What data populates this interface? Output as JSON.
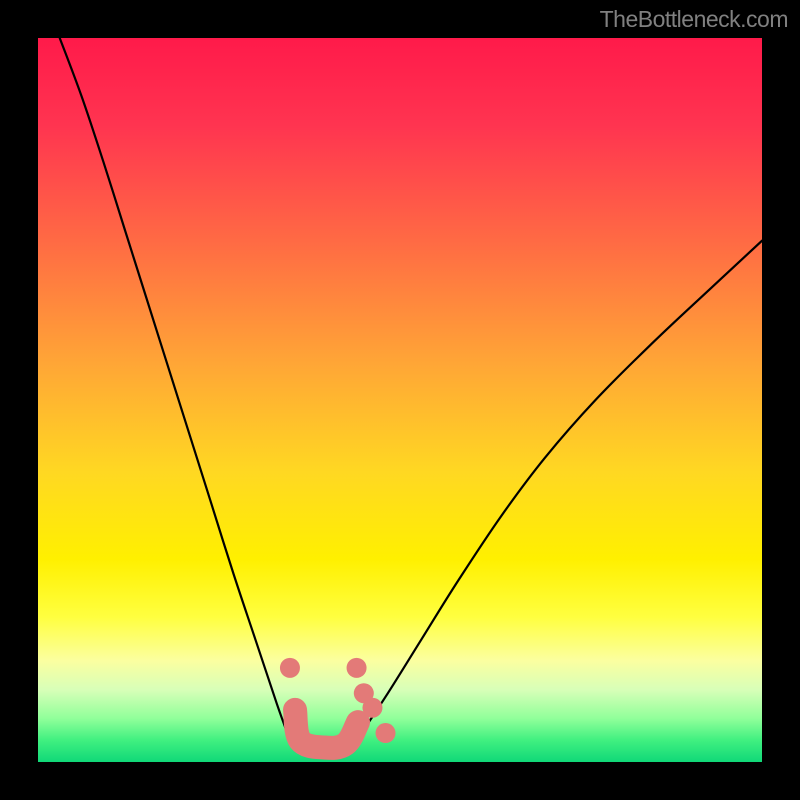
{
  "watermark": "TheBottleneck.com",
  "chart_data": {
    "type": "line",
    "title": "",
    "xlabel": "",
    "ylabel": "",
    "xlim": [
      0,
      1
    ],
    "ylim": [
      0,
      1
    ],
    "background": {
      "type": "vertical-gradient",
      "stops": [
        {
          "offset": 0.0,
          "color": "#ff1a4a"
        },
        {
          "offset": 0.12,
          "color": "#ff3450"
        },
        {
          "offset": 0.28,
          "color": "#ff6a44"
        },
        {
          "offset": 0.45,
          "color": "#ffa636"
        },
        {
          "offset": 0.6,
          "color": "#ffd822"
        },
        {
          "offset": 0.72,
          "color": "#fff000"
        },
        {
          "offset": 0.8,
          "color": "#ffff40"
        },
        {
          "offset": 0.86,
          "color": "#fbffa0"
        },
        {
          "offset": 0.9,
          "color": "#d8ffb8"
        },
        {
          "offset": 0.94,
          "color": "#90ff9a"
        },
        {
          "offset": 0.97,
          "color": "#40f080"
        },
        {
          "offset": 1.0,
          "color": "#10d878"
        }
      ]
    },
    "series": [
      {
        "name": "left-curve",
        "x": [
          0.03,
          0.06,
          0.09,
          0.12,
          0.15,
          0.18,
          0.21,
          0.24,
          0.27,
          0.3,
          0.33,
          0.348
        ],
        "y": [
          1.0,
          0.92,
          0.83,
          0.735,
          0.64,
          0.545,
          0.45,
          0.355,
          0.26,
          0.17,
          0.08,
          0.03
        ]
      },
      {
        "name": "right-curve",
        "x": [
          0.44,
          0.48,
          0.53,
          0.58,
          0.64,
          0.7,
          0.77,
          0.85,
          0.93,
          1.0
        ],
        "y": [
          0.03,
          0.09,
          0.17,
          0.25,
          0.34,
          0.42,
          0.5,
          0.58,
          0.655,
          0.72
        ]
      }
    ],
    "markers": [
      {
        "x": 0.348,
        "y": 0.13,
        "r": 10
      },
      {
        "x": 0.44,
        "y": 0.13,
        "r": 10
      },
      {
        "x": 0.45,
        "y": 0.095,
        "r": 10
      },
      {
        "x": 0.462,
        "y": 0.075,
        "r": 10
      },
      {
        "x": 0.48,
        "y": 0.04,
        "r": 10
      }
    ],
    "thick_segment": {
      "points": [
        {
          "x": 0.355,
          "y": 0.072
        },
        {
          "x": 0.362,
          "y": 0.03
        },
        {
          "x": 0.395,
          "y": 0.02
        },
        {
          "x": 0.425,
          "y": 0.025
        },
        {
          "x": 0.442,
          "y": 0.055
        }
      ],
      "color": "#e37a78",
      "width": 24
    }
  }
}
